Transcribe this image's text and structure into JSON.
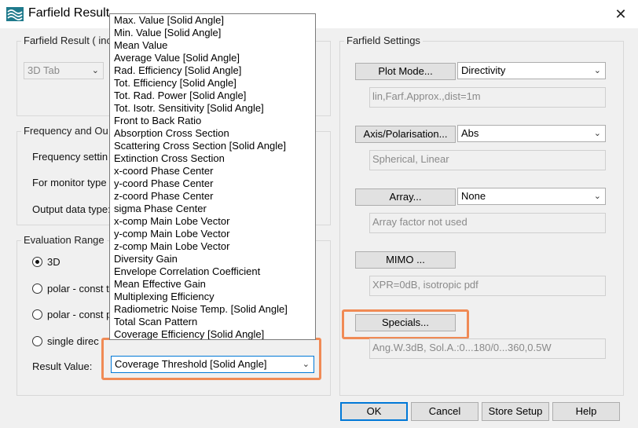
{
  "window": {
    "title": "Farfield Result",
    "close_glyph": "✕"
  },
  "farfield_result_group": {
    "label": "Farfield Result ( inc",
    "tab_combo_value": "3D Tab"
  },
  "freq_output_group": {
    "label": "Frequency and Ou",
    "frequency_setting_label": "Frequency settin",
    "monitor_type_label": "For monitor type",
    "output_data_type_label": "Output data type:"
  },
  "evaluation_range_group": {
    "label": "Evaluation Range",
    "radio_3d": "3D",
    "radio_polar_t": "polar - const t",
    "radio_polar_p": "polar - const p",
    "radio_single": "single direc",
    "result_value_label": "Result Value:"
  },
  "result_value_dropdown": {
    "selected": "Coverage Threshold [Solid Angle]",
    "options": [
      "Max. Value [Solid Angle]",
      "Min. Value [Solid Angle]",
      "Mean Value",
      "Average Value [Solid Angle]",
      "Rad. Efficiency [Solid Angle]",
      "Tot. Efficiency [Solid Angle]",
      "Tot. Rad. Power [Solid Angle]",
      "Tot. Isotr. Sensitivity [Solid Angle]",
      "Front to Back Ratio",
      "Absorption Cross Section",
      "Scattering Cross Section [Solid Angle]",
      "Extinction Cross Section",
      "x-coord Phase Center",
      "y-coord Phase Center",
      "z-coord Phase Center",
      "sigma Phase Center",
      "x-comp Main Lobe Vector",
      "y-comp Main Lobe Vector",
      "z-comp Main Lobe Vector",
      "Diversity Gain",
      "Envelope Correlation Coefficient",
      "Mean Effective Gain",
      "Multiplexing Efficiency",
      "Radiometric Noise Temp. [Solid Angle]",
      "Total Scan Pattern",
      "Coverage Efficiency [Solid Angle]",
      "Coverage Threshold [Solid Angle]"
    ],
    "highlighted_index": 26
  },
  "farfield_settings": {
    "label": "Farfield Settings",
    "plot_mode_button": "Plot Mode...",
    "plot_mode_value": "Directivity",
    "plot_mode_info": "lin,Farf.Approx.,dist=1m",
    "axis_button": "Axis/Polarisation...",
    "axis_value": "Abs",
    "axis_info": "Spherical, Linear",
    "array_button": "Array...",
    "array_value": "None",
    "array_info": "Array factor not used",
    "mimo_button": "MIMO ...",
    "mimo_info": "XPR=0dB, isotropic pdf",
    "specials_button": "Specials...",
    "specials_info": "Ang.W.3dB, Sol.A.:0...180/0...360,0.5W"
  },
  "footer": {
    "ok": "OK",
    "cancel": "Cancel",
    "store_setup": "Store Setup",
    "help": "Help"
  },
  "colors": {
    "highlight": "#f08a55",
    "selection": "#0078d7",
    "app_icon": "#1f7a8c"
  }
}
